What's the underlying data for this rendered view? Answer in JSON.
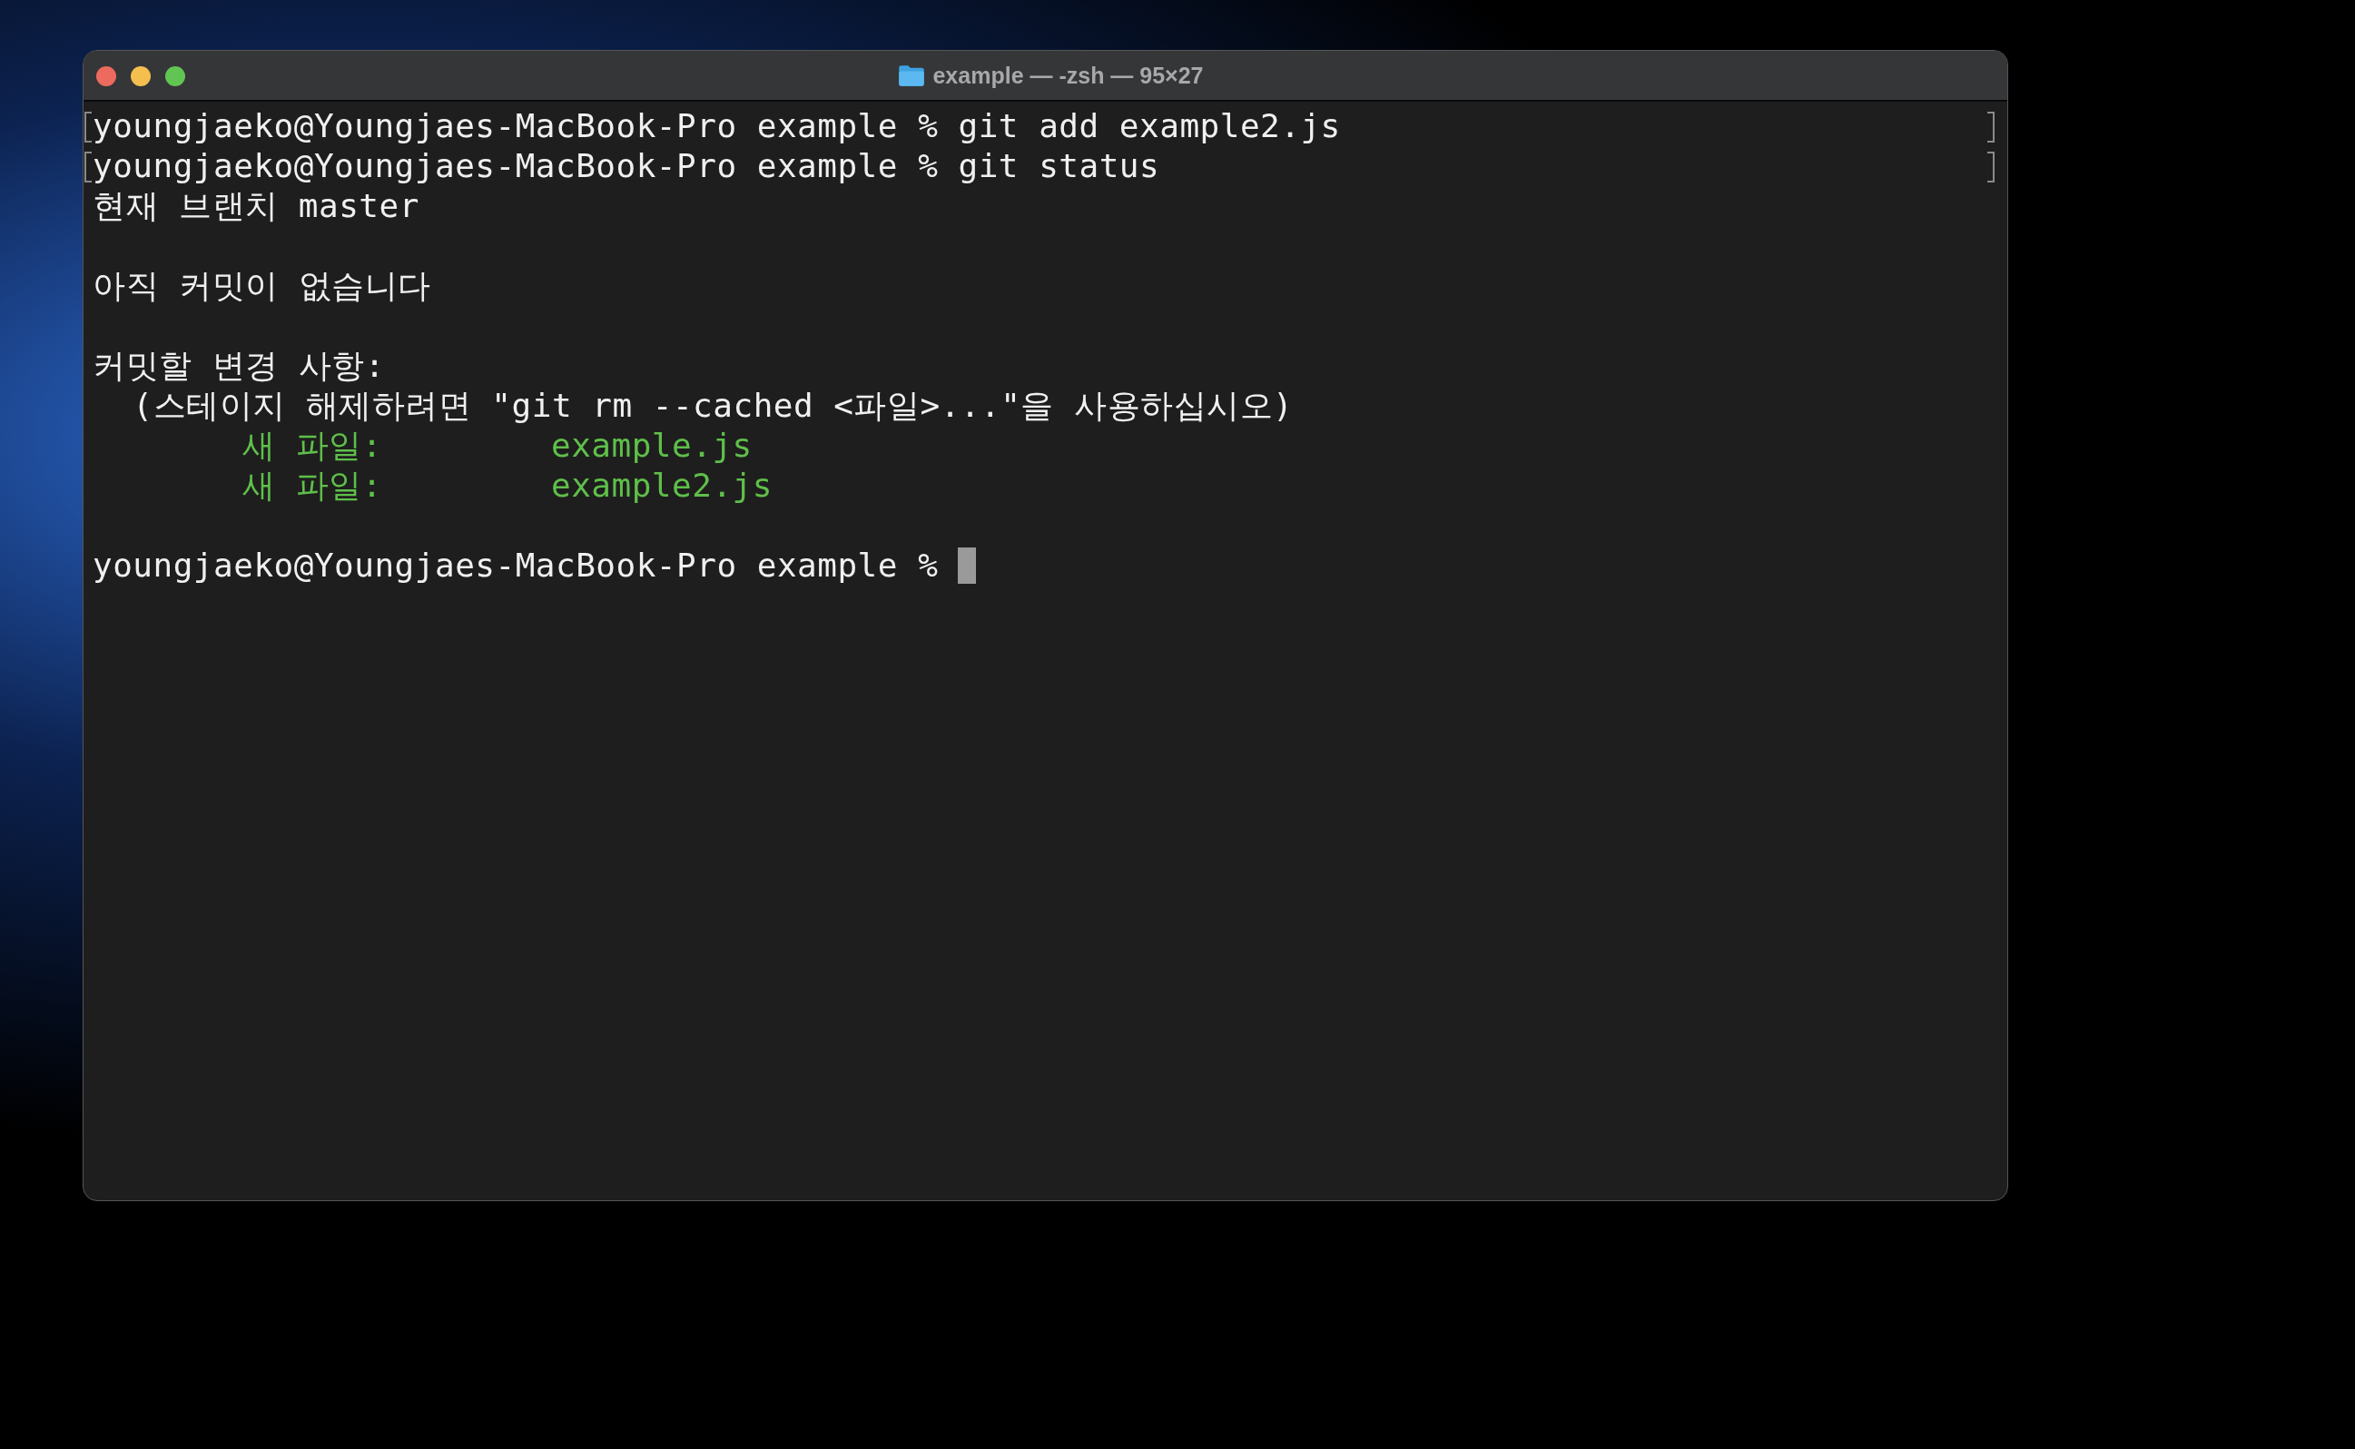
{
  "window": {
    "title": "example — -zsh — 95×27"
  },
  "lines": [
    {
      "kind": "command",
      "prompt": "youngjaeko@Youngjaes-MacBook-Pro example %",
      "command": "git add example2.js",
      "marked": true
    },
    {
      "kind": "command",
      "prompt": "youngjaeko@Youngjaes-MacBook-Pro example %",
      "command": "git status",
      "marked": true
    },
    {
      "kind": "output",
      "text": "현재 브랜치 master"
    },
    {
      "kind": "blank"
    },
    {
      "kind": "output",
      "text": "아직 커밋이 없습니다"
    },
    {
      "kind": "blank"
    },
    {
      "kind": "output",
      "text": "커밋할 변경 사항:"
    },
    {
      "kind": "output",
      "text": "  (스테이지 해제하려면 \"git rm --cached <파일>...\"을 사용하십시오)"
    },
    {
      "kind": "new_file",
      "label": "새 파일:",
      "file": "example.js"
    },
    {
      "kind": "new_file",
      "label": "새 파일:",
      "file": "example2.js"
    },
    {
      "kind": "blank"
    },
    {
      "kind": "prompt",
      "prompt": "youngjaeko@Youngjaes-MacBook-Pro example %",
      "cursor": true
    }
  ]
}
